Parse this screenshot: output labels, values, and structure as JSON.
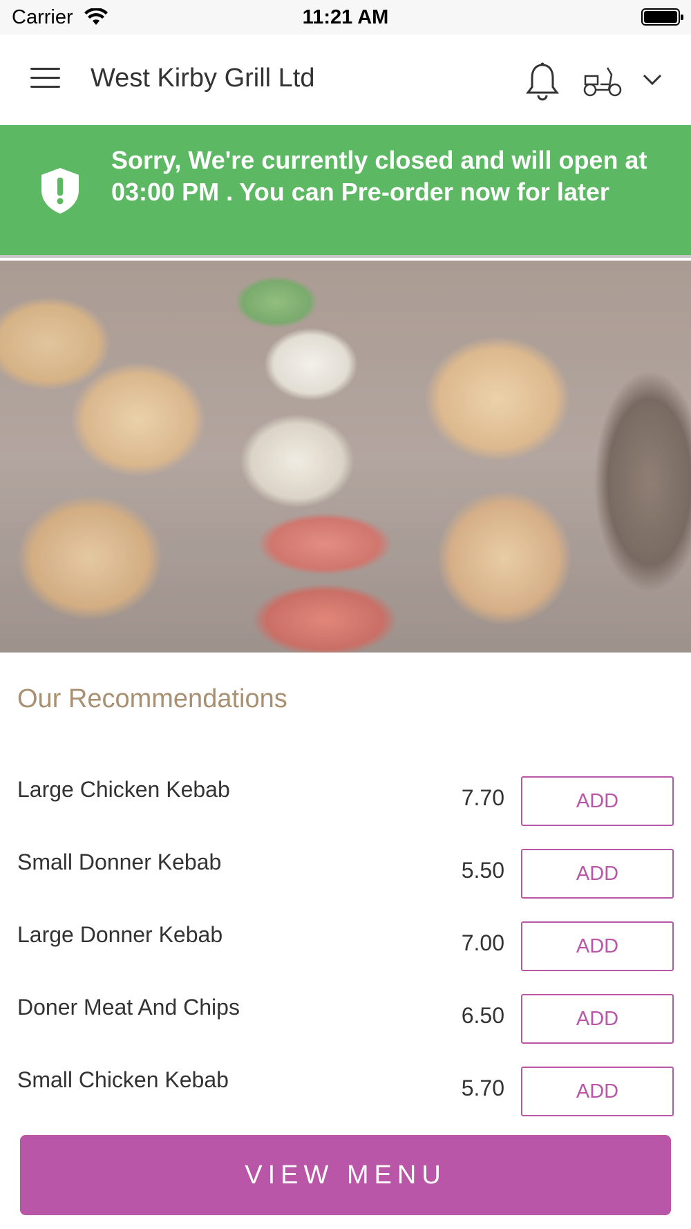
{
  "status_bar": {
    "carrier": "Carrier",
    "time": "11:21 AM",
    "wifi_icon": "wifi-icon",
    "battery_icon": "battery-icon"
  },
  "header": {
    "title": "West Kirby Grill Ltd",
    "menu_icon": "hamburger-menu-icon",
    "notification_icon": "bell-icon",
    "delivery_icon": "scooter-icon",
    "dropdown_icon": "chevron-down-icon"
  },
  "banner": {
    "message": "Sorry, We're currently closed and will open at 03:00 PM . You can Pre-order now for later",
    "icon": "shield-alert-icon",
    "background_color": "#5cb862"
  },
  "recommendations": {
    "title": "Our Recommendations",
    "items": [
      {
        "name": "Large Chicken Kebab",
        "price": "7.70",
        "add_label": "ADD"
      },
      {
        "name": "Small Donner Kebab",
        "price": "5.50",
        "add_label": "ADD"
      },
      {
        "name": "Large Donner Kebab",
        "price": "7.00",
        "add_label": "ADD"
      },
      {
        "name": "Doner Meat And Chips",
        "price": "6.50",
        "add_label": "ADD"
      },
      {
        "name": "Small Chicken Kebab",
        "price": "5.70",
        "add_label": "ADD"
      }
    ]
  },
  "footer": {
    "view_menu_label": "VIEW MENU"
  },
  "colors": {
    "accent": "#b956a8",
    "section_title": "#a89070",
    "banner": "#5cb862"
  }
}
